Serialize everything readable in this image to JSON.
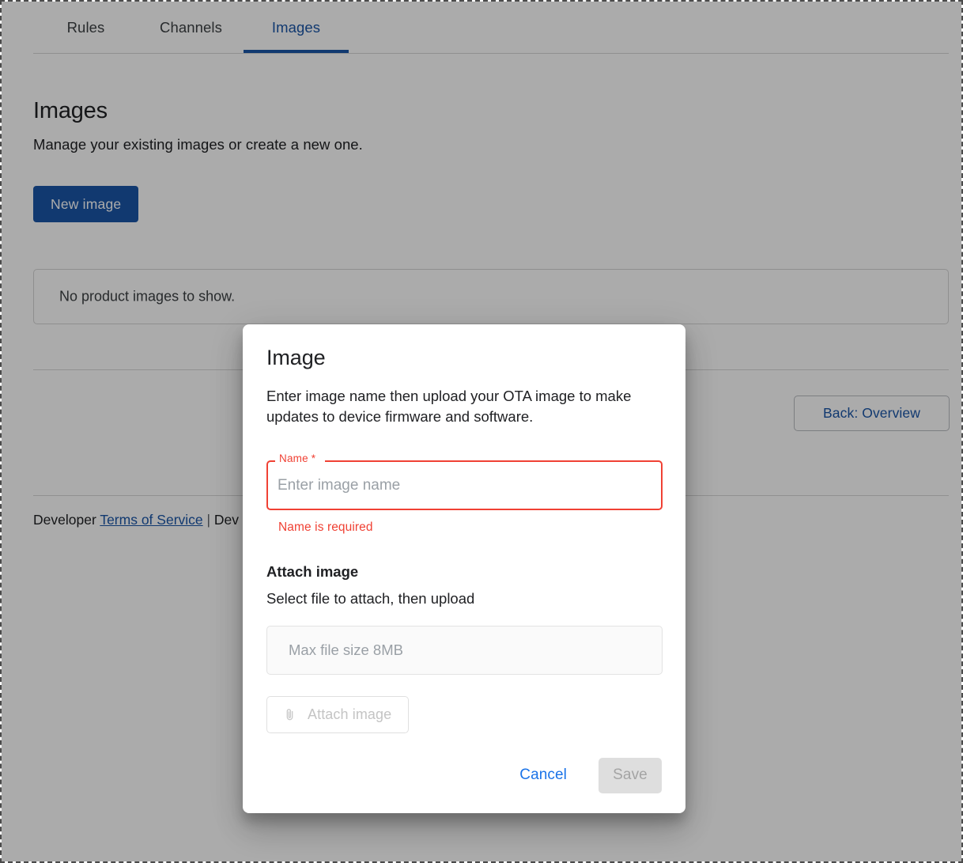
{
  "tabs": [
    {
      "label": "Rules",
      "active": false
    },
    {
      "label": "Channels",
      "active": false
    },
    {
      "label": "Images",
      "active": true
    }
  ],
  "page": {
    "title": "Images",
    "subtitle": "Manage your existing images or create a new one.",
    "new_image_label": "New image",
    "empty_state": "No product images to show.",
    "back_button_label": "Back: Overview"
  },
  "footer": {
    "lead": "Developer ",
    "terms_link": "Terms of Service",
    "separator": " | ",
    "trailing": "Dev"
  },
  "modal": {
    "title": "Image",
    "description": "Enter image name then upload your OTA image to make updates to device firmware and software.",
    "name_label": "Name *",
    "name_value": "",
    "name_placeholder": "Enter image name",
    "name_error": "Name is required",
    "attach_heading": "Attach image",
    "attach_subtext": "Select file to attach, then upload",
    "file_size_hint": "Max file size 8MB",
    "attach_button_label": "Attach image",
    "attach_button_icon": "paperclip-icon",
    "cancel_label": "Cancel",
    "save_label": "Save"
  },
  "colors": {
    "accent_blue": "#1a56a8",
    "link_blue": "#1a73e8",
    "error_red": "#f04134",
    "disabled_grey": "#a4a4a4"
  }
}
